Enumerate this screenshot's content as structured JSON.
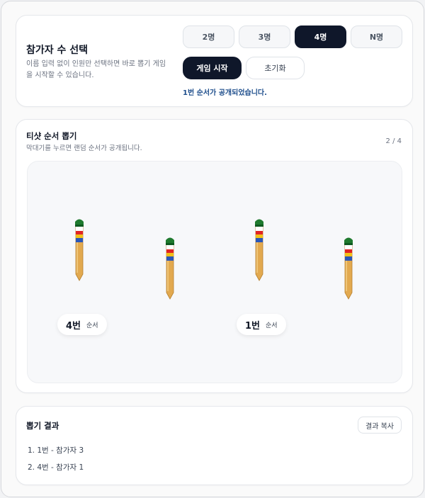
{
  "setup": {
    "title": "참가자 수 선택",
    "desc_line1": "이름 입력 없이 인원만 선택하면 바로 뽑기 게임",
    "desc_line2": "을 시작할 수 있습니다.",
    "options": [
      "2명",
      "3명",
      "4명",
      "N명"
    ],
    "selected": "4명",
    "start_label": "게임 시작",
    "reset_label": "초기화",
    "status_text": "1번 순서가 공개되었습니다."
  },
  "draw": {
    "title": "티샷 순서 뽑기",
    "desc": "막대기를 누르면 랜덤 순서가 공개됩니다.",
    "counter": "2 / 4",
    "sticks": [
      {
        "state": "raised",
        "badge_num": "4번",
        "badge_label": "순서"
      },
      {
        "state": "lowered"
      },
      {
        "state": "raised",
        "badge_num": "1번",
        "badge_label": "순서"
      },
      {
        "state": "lowered"
      }
    ],
    "stick_colors": {
      "cap": "#1f7a2e",
      "white": "#ffffff",
      "red": "#e02424",
      "yellow": "#f2c018",
      "blue": "#2a56b8",
      "wood": "#e2a94f"
    }
  },
  "result": {
    "title": "뽑기 결과",
    "copy_label": "결과 복사",
    "items": [
      "1. 1번 - 참가자 3",
      "2. 4번 - 참가자 1"
    ]
  }
}
